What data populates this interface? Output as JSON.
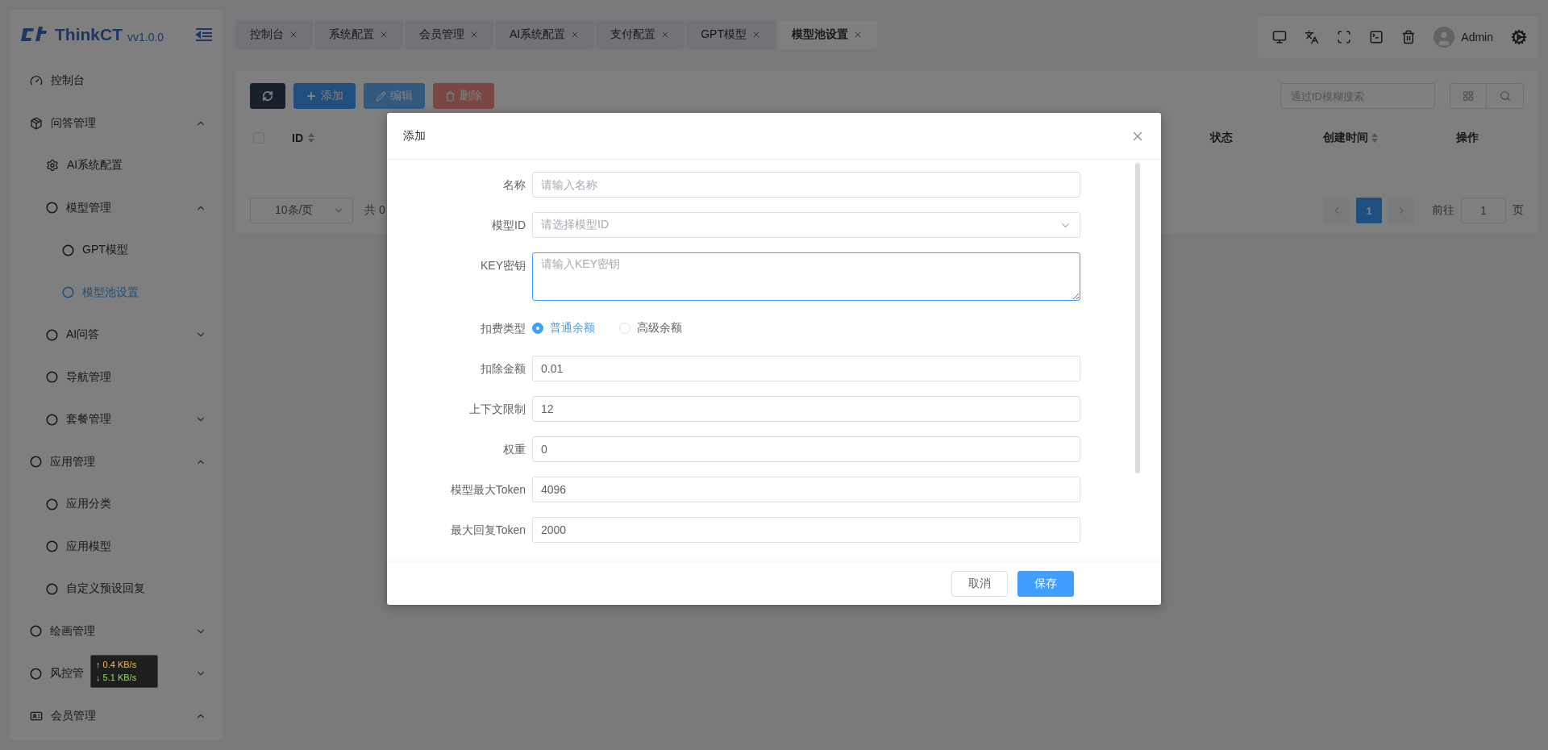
{
  "logo": {
    "name": "ThinkCT",
    "version": "vv1.0.0"
  },
  "menu": [
    {
      "label": "控制台",
      "selected": false
    },
    {
      "label": "问答管理",
      "selected": false,
      "expanded": true,
      "children": [
        {
          "label": "AI系统配置",
          "selected": false
        },
        {
          "label": "模型管理",
          "selected": false,
          "expanded": true,
          "children": [
            {
              "label": "GPT模型",
              "selected": false
            },
            {
              "label": "模型池设置",
              "selected": true
            }
          ]
        },
        {
          "label": "AI问答",
          "selected": false,
          "expanded": false
        },
        {
          "label": "导航管理",
          "selected": false
        },
        {
          "label": "套餐管理",
          "selected": false,
          "expanded": false
        }
      ]
    },
    {
      "label": "应用管理",
      "selected": false,
      "expanded": true,
      "children": [
        {
          "label": "应用分类",
          "selected": false
        },
        {
          "label": "应用模型",
          "selected": false
        },
        {
          "label": "自定义预设回复",
          "selected": false
        }
      ]
    },
    {
      "label": "绘画管理",
      "selected": false,
      "expanded": false
    },
    {
      "label": "风控管",
      "selected": false,
      "expanded": false
    },
    {
      "label": "会员管理",
      "selected": false,
      "expanded": true
    }
  ],
  "tabs": [
    {
      "label": "控制台",
      "selected": false
    },
    {
      "label": "系统配置",
      "selected": false
    },
    {
      "label": "会员管理",
      "selected": false
    },
    {
      "label": "AI系统配置",
      "selected": false
    },
    {
      "label": "支付配置",
      "selected": false
    },
    {
      "label": "GPT模型",
      "selected": false
    },
    {
      "label": "模型池设置",
      "selected": true
    }
  ],
  "user": {
    "name": "Admin"
  },
  "toolbar": {
    "buttons": [
      {
        "kind": "refresh",
        "disabled": false
      },
      {
        "kind": "add",
        "label": "添加",
        "disabled": false
      },
      {
        "kind": "edit",
        "label": "编辑",
        "disabled": true
      },
      {
        "kind": "delete",
        "label": "删除",
        "disabled": true
      }
    ],
    "search": {
      "placeholder": "通过ID模糊搜索"
    }
  },
  "table": {
    "select_all": {
      "checked": false
    },
    "columns": [
      {
        "label": "ID",
        "sortable": true
      },
      {
        "label": "状态",
        "sortable": false
      },
      {
        "label": "创建时间",
        "sortable": true
      },
      {
        "label": "操作",
        "sortable": false
      }
    ]
  },
  "pagination": {
    "page_size": "10条/页",
    "total": "共 0",
    "pages": [
      {
        "label": "1",
        "selected": true
      }
    ],
    "goto_label": "前往",
    "goto_value": "1",
    "goto_unit": "页"
  },
  "dialog": {
    "title": "添加",
    "fields": [
      {
        "kind": "text",
        "label": "名称",
        "placeholder": "请输入名称"
      },
      {
        "kind": "select",
        "label": "模型ID",
        "placeholder": "请选择模型ID"
      },
      {
        "kind": "textarea",
        "label": "KEY密钥",
        "placeholder": "请输入KEY密钥"
      },
      {
        "kind": "radio",
        "label": "扣费类型",
        "options": [
          {
            "label": "普通余额",
            "selected": true
          },
          {
            "label": "高级余额",
            "selected": false
          }
        ]
      },
      {
        "kind": "text",
        "label": "扣除金额",
        "value": "0.01"
      },
      {
        "kind": "text",
        "label": "上下文限制",
        "value": "12"
      },
      {
        "kind": "text",
        "label": "权重",
        "value": "0"
      },
      {
        "kind": "text",
        "label": "模型最大Token",
        "value": "4096"
      },
      {
        "kind": "text",
        "label": "最大回复Token",
        "value": "2000"
      }
    ],
    "cancel": "取消",
    "save": "保存"
  },
  "net_speed": {
    "up": "↑ 0.4 KB/s",
    "down": "↓ 5.1 KB/s"
  }
}
